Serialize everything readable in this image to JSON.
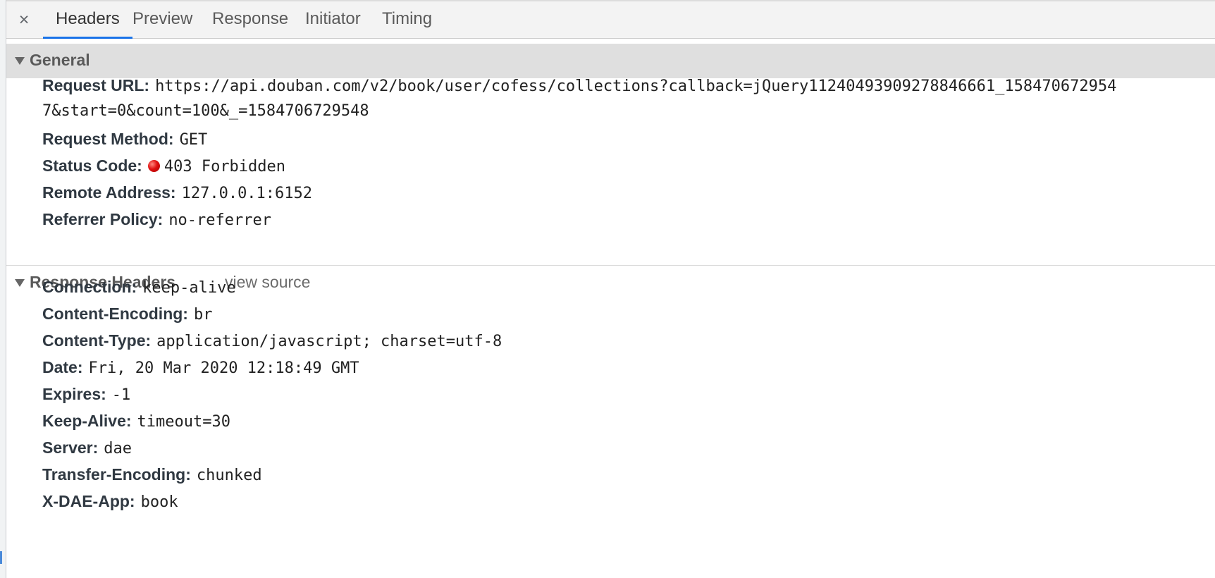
{
  "tabs": {
    "close": "×",
    "items": [
      "Headers",
      "Preview",
      "Response",
      "Initiator",
      "Timing"
    ]
  },
  "general": {
    "title": "General",
    "request_url_key": "Request URL:",
    "request_url_line1": "https://api.douban.com/v2/book/user/cofess/collections?callback=jQuery11240493909278846661_158470672954",
    "request_url_line2": "7&start=0&count=100&_=1584706729548",
    "request_method_key": "Request Method:",
    "request_method": "GET",
    "status_code_key": "Status Code:",
    "status_code": "403 Forbidden",
    "status_color": "#e01010",
    "remote_address_key": "Remote Address:",
    "remote_address": "127.0.0.1:6152",
    "referrer_policy_key": "Referrer Policy:",
    "referrer_policy": "no-referrer"
  },
  "response_headers": {
    "title": "Response Headers",
    "view_source": "view source",
    "items": [
      {
        "key": "Connection:",
        "value": "keep-alive"
      },
      {
        "key": "Content-Encoding:",
        "value": "br"
      },
      {
        "key": "Content-Type:",
        "value": "application/javascript; charset=utf-8"
      },
      {
        "key": "Date:",
        "value": "Fri, 20 Mar 2020 12:18:49 GMT"
      },
      {
        "key": "Expires:",
        "value": "-1"
      },
      {
        "key": "Keep-Alive:",
        "value": "timeout=30"
      },
      {
        "key": "Server:",
        "value": "dae"
      },
      {
        "key": "Transfer-Encoding:",
        "value": "chunked"
      },
      {
        "key": "X-DAE-App:",
        "value": "book"
      }
    ]
  },
  "colors": {
    "active_tab_underline": "#1a73e8",
    "general_header_bg": "#dfdfdf"
  }
}
